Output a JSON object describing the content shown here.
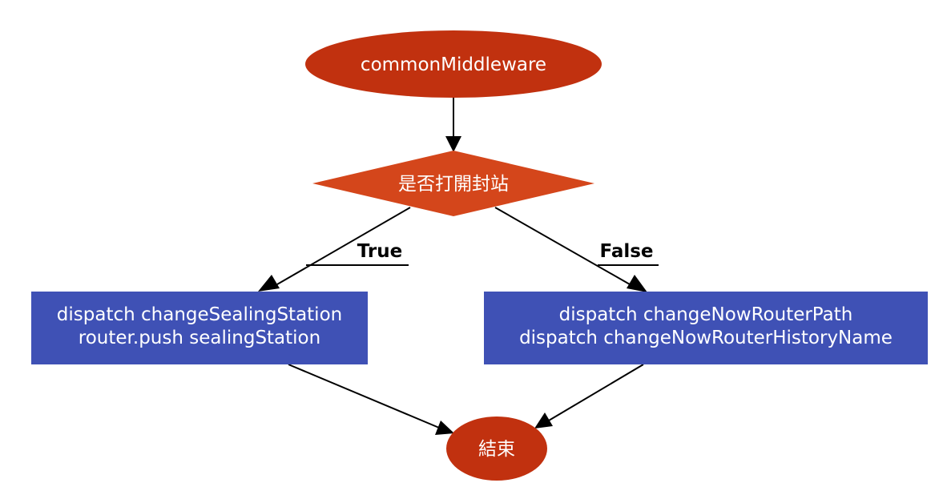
{
  "diagram": {
    "start": {
      "label": "commonMiddleware",
      "color": "#c1310f"
    },
    "decision": {
      "label": "是否打開封站",
      "color": "#d4461b"
    },
    "true_branch": {
      "label": "True",
      "lines": [
        "dispatch changeSealingStation",
        "router.push sealingStation"
      ],
      "color": "#3f51b5"
    },
    "false_branch": {
      "label": "False",
      "lines": [
        "dispatch changeNowRouterPath",
        "dispatch changeNowRouterHistoryName"
      ],
      "color": "#3f51b5"
    },
    "end": {
      "label": "結束",
      "color": "#c1310f"
    }
  }
}
